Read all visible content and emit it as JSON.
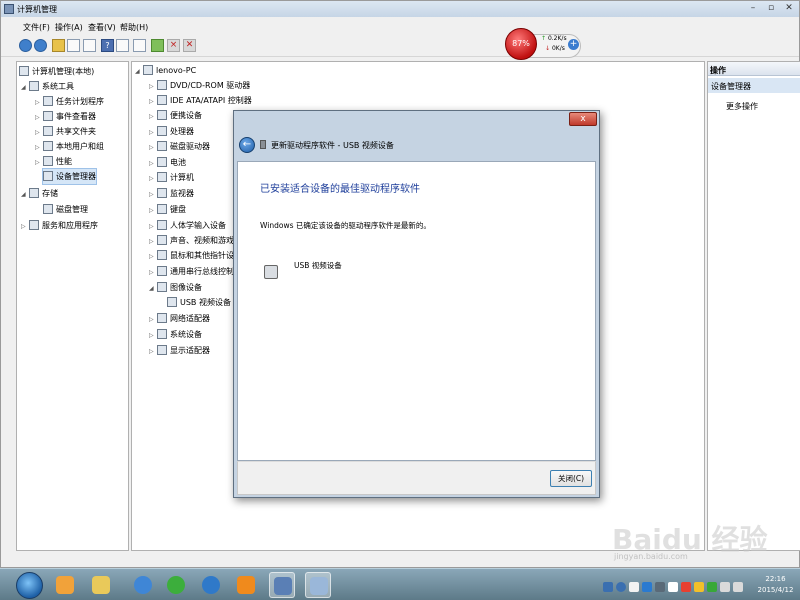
{
  "window": {
    "title": "计算机管理"
  },
  "menubar": [
    "文件(F)",
    "操作(A)",
    "查看(V)",
    "帮助(H)"
  ],
  "netmon": {
    "percent": "87%",
    "up": "0.2K/s",
    "down": "0K/s"
  },
  "tree": {
    "items": [
      "计算机管理(本地)",
      "系统工具",
      "任务计划程序",
      "事件查看器",
      "共享文件夹",
      "本地用户和组",
      "性能",
      "设备管理器",
      "存储",
      "磁盘管理",
      "服务和应用程序"
    ]
  },
  "devices": {
    "root": "lenovo-PC",
    "items": [
      "DVD/CD-ROM 驱动器",
      "IDE ATA/ATAPI 控制器",
      "便携设备",
      "处理器",
      "磁盘驱动器",
      "电池",
      "计算机",
      "监视器",
      "键盘",
      "人体学输入设备",
      "声音、视频和游戏控制器",
      "鼠标和其他指针设备",
      "通用串行总线控制器",
      "图像设备",
      "USB 视频设备",
      "网络适配器",
      "系统设备",
      "显示适配器"
    ]
  },
  "actions": {
    "header": "操作",
    "section": "设备管理器",
    "more": "更多操作"
  },
  "dialog": {
    "title": "更新驱动程序软件 - USB 视频设备",
    "heading": "已安装适合设备的最佳驱动程序软件",
    "message": "Windows 已确定该设备的驱动程序软件是最新的。",
    "device": "USB 视频设备",
    "close_label": "关闭(C)",
    "close_x": "x"
  },
  "clock": {
    "time": "22:16",
    "date": "2015/4/12"
  },
  "watermark": {
    "brand": "Baidu 经验",
    "url": "jingyan.baidu.com"
  }
}
